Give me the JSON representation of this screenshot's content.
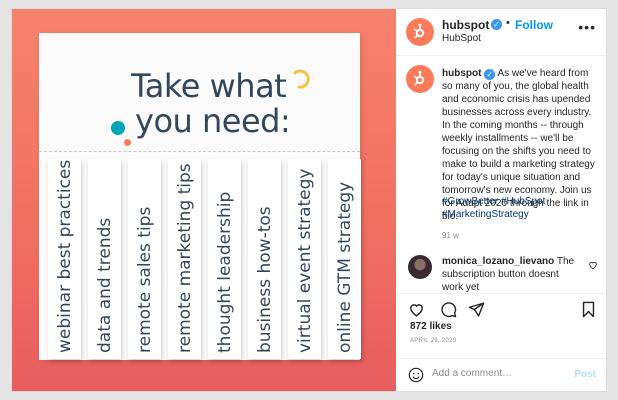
{
  "flyer": {
    "title_line1": "Take what",
    "title_line2": "you need:",
    "tabs": [
      "webinar best practices",
      "data and trends",
      "remote sales tips",
      "remote marketing tips",
      "thought leadership",
      "business how-tos",
      "virtual event strategy",
      "online GTM strategy"
    ]
  },
  "header": {
    "username": "hubspot",
    "follow_label": "Follow",
    "subtitle": "HubSpot",
    "dot": "•",
    "more_icon": "more-horizontal-icon"
  },
  "caption": {
    "username": "hubspot",
    "text": "As we've heard from so many of you, the global health and economic crisis has upended businesses across every industry. In the coming months -- through weekly installments -- we'll be focusing on the shifts you need to make to build a marketing strategy for today's unique situation and tomorrow's new economy. Join us for Adapt 2020 through the link in bio.",
    "hashtags": "#GrowBetter #HubSpot #MarketingStrategy",
    "age": "91 w"
  },
  "comment": {
    "username": "monica_lozano_lievano",
    "text": "The subscription button doesnt work yet"
  },
  "stats": {
    "likes": "872 likes",
    "date": "APRIL 29, 2020"
  },
  "add_comment": {
    "placeholder": "Add a comment…",
    "post_label": "Post"
  },
  "colors": {
    "brand": "#ff7a59",
    "link": "#0095f6",
    "gradient_top": "#f7826c",
    "gradient_bottom": "#e85e60",
    "navy": "#33475b",
    "teal": "#00a4bd"
  }
}
